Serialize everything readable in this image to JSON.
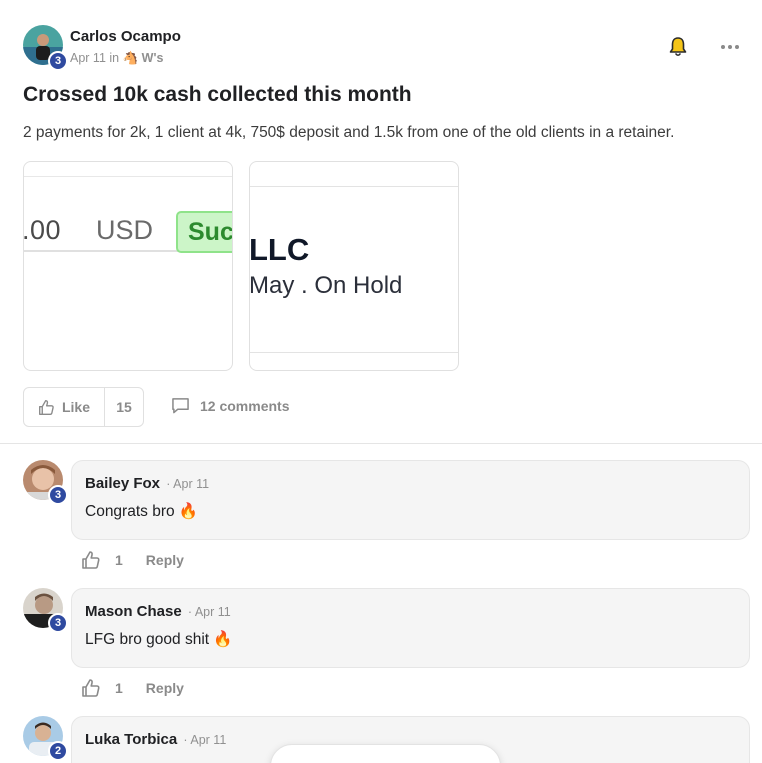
{
  "post": {
    "author": "Carlos Ocampo",
    "author_level": "3",
    "date": "Apr 11",
    "in_label": "in",
    "group_emoji": "🐴",
    "group": "W's",
    "title": "Crossed 10k cash collected this month",
    "body": "2 payments for 2k, 1 client at 4k, 750$ deposit and 1.5k from one of the old clients in a retainer.",
    "attachments": [
      {
        "amount": ".00",
        "currency": "USD",
        "status": "Succ"
      },
      {
        "company": "LLC",
        "status_line": "May . On Hold"
      }
    ],
    "like_label": "Like",
    "like_count": "15",
    "comments_label": "12 comments"
  },
  "comments": [
    {
      "author": "Bailey Fox",
      "level": "3",
      "date": "· Apr 11",
      "text": "Congrats bro 🔥",
      "likes": "1",
      "reply_label": "Reply"
    },
    {
      "author": "Mason Chase",
      "level": "3",
      "date": "· Apr 11",
      "text": "LFG bro good shit 🔥",
      "likes": "1",
      "reply_label": "Reply"
    },
    {
      "author": "Luka Torbica",
      "level": "2",
      "date": "· Apr 11"
    }
  ],
  "icons": {
    "bell": "bell-icon",
    "more": "more-icon",
    "like": "thumbs-up-icon",
    "comment": "comment-icon"
  },
  "colors": {
    "level_badge": "#2f4aa0",
    "bell": "#f5c518",
    "status_green": "#ccf5c8"
  }
}
